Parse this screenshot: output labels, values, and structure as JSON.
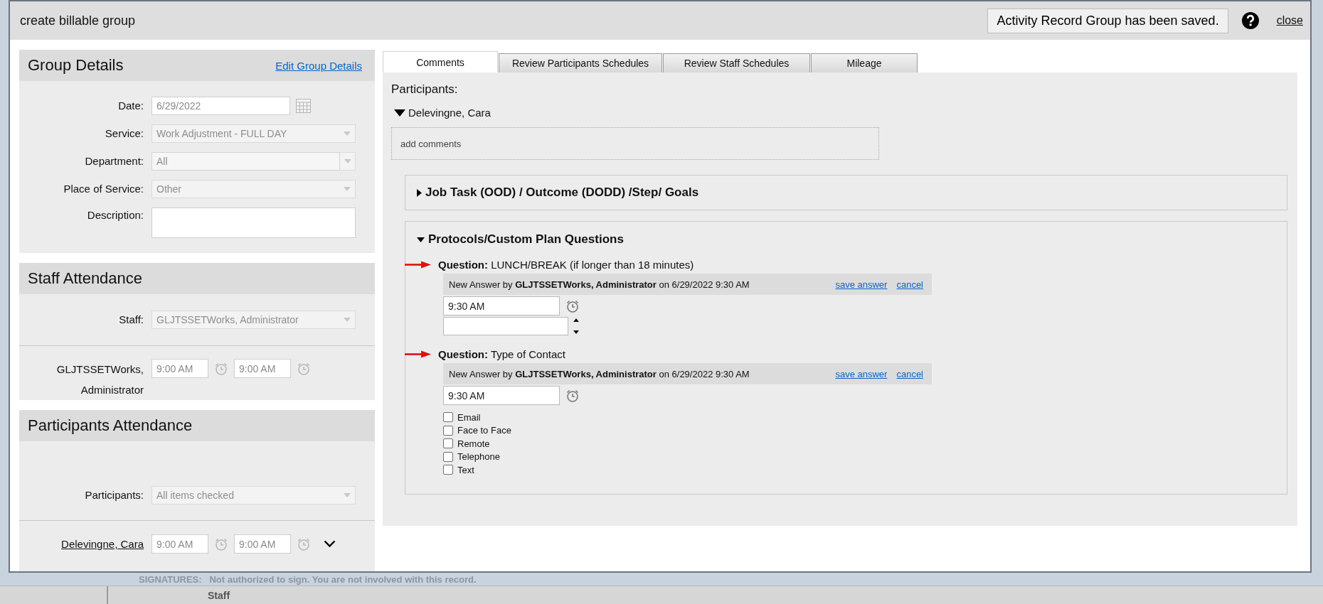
{
  "dialog": {
    "title": "create billable group",
    "status_message": "Activity Record Group has been saved.",
    "close_link": "close"
  },
  "group_details": {
    "title": "Group Details",
    "edit_link": "Edit Group Details",
    "fields": [
      {
        "kind": "date",
        "label": "Date:",
        "value": "6/29/2022"
      },
      {
        "kind": "select",
        "label": "Service:",
        "value": "Work Adjustment - FULL DAY"
      },
      {
        "kind": "combo",
        "label": "Department:",
        "value": "All"
      },
      {
        "kind": "select",
        "label": "Place of Service:",
        "value": "Other"
      },
      {
        "kind": "textarea",
        "label": "Description:"
      }
    ]
  },
  "staff_attendance": {
    "title": "Staff Attendance",
    "select": {
      "label": "Staff:",
      "value": "GLJTSSETWorks, Administrator"
    },
    "rows": [
      {
        "kind": "text",
        "name": "GLJTSSETWorks, Administrator",
        "time_in": "9:00 AM",
        "time_out": "9:00 AM"
      }
    ]
  },
  "participants_attendance": {
    "title": "Participants Attendance",
    "select": {
      "label": "Participants:",
      "value": "All items checked"
    },
    "rows": [
      {
        "kind": "link",
        "name": "Delevingne, Cara",
        "time_in": "9:00 AM",
        "time_out": "9:00 AM",
        "expanded": false
      }
    ]
  },
  "tabs": [
    {
      "label": "Comments",
      "selected": true
    },
    {
      "label": "Review Participants Schedules",
      "selected": false
    },
    {
      "label": "Review Staff Schedules",
      "selected": false
    },
    {
      "label": "Mileage",
      "selected": false
    }
  ],
  "comments": {
    "participants_label": "Participants:",
    "participant": {
      "name": "Delevingne, Cara",
      "expanded": true
    },
    "comment_placeholder": "add comments",
    "sections": [
      {
        "title": "Job Task (OOD) / Outcome (DODD) /Step/ Goals",
        "expanded": false
      },
      {
        "title": "Protocols/Custom Plan Questions",
        "expanded": true,
        "questions": [
          {
            "kind": "number",
            "question": "**Question:** LUNCH/BREAK (if longer than 18 minutes)",
            "answer_header": "New Answer by **GLJTSSETWorks, Administrator** on 6/29/2022 9:30 AM",
            "save_link": "save answer",
            "cancel_link": "cancel",
            "time": "9:30 AM"
          },
          {
            "kind": "checklist",
            "question": "**Question:** Type of Contact",
            "answer_header": "New Answer by **GLJTSSETWorks, Administrator** on 6/29/2022 9:30 AM",
            "save_link": "save answer",
            "cancel_link": "cancel",
            "time": "9:30 AM",
            "options": [
              {
                "label": "Email",
                "checked": false
              },
              {
                "label": "Face to Face",
                "checked": false
              },
              {
                "label": "Remote",
                "checked": false
              },
              {
                "label": "Telephone",
                "checked": false
              },
              {
                "label": "Text",
                "checked": false
              }
            ]
          }
        ]
      }
    ]
  },
  "background": {
    "signatures": "SIGNATURES:   Not authorized to sign. You are not involved with this record.",
    "column_header": "Staff"
  }
}
